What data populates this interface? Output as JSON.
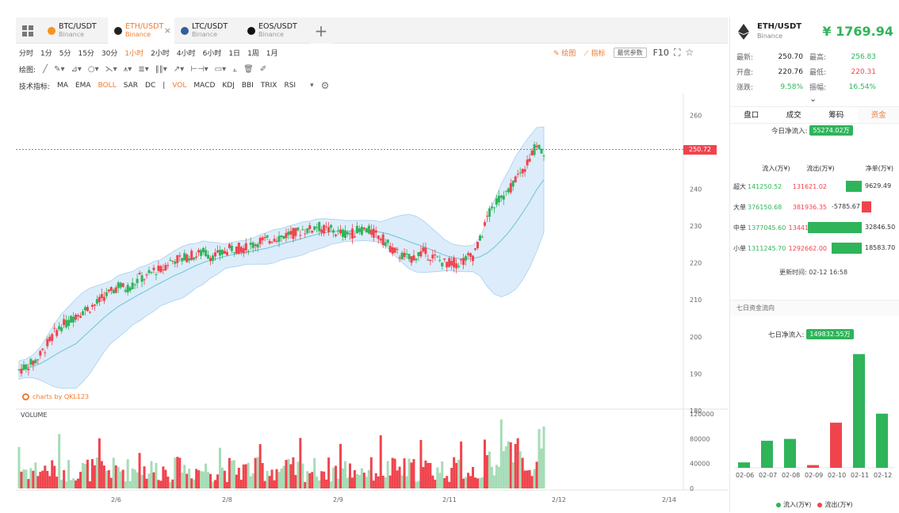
{
  "tabs": [
    {
      "pair": "BTC/USDT",
      "exchange": "Binance",
      "color": "#f7931a",
      "active": false
    },
    {
      "pair": "ETH/USDT",
      "exchange": "Binance",
      "color": "#222222",
      "active": true
    },
    {
      "pair": "LTC/USDT",
      "exchange": "Binance",
      "color": "#345d9d",
      "active": false
    },
    {
      "pair": "EOS/USDT",
      "exchange": "Binance",
      "color": "#111111",
      "active": false
    }
  ],
  "periods": [
    "分时",
    "1分",
    "5分",
    "15分",
    "30分",
    "1小时",
    "2小时",
    "4小时",
    "6小时",
    "1日",
    "1周",
    "1月"
  ],
  "active_period": "1小时",
  "draw_label": "绘图:",
  "indicators_label": "技术指标:",
  "indicators": [
    "MA",
    "EMA",
    "BOLL",
    "SAR",
    "DC",
    "|",
    "VOL",
    "MACD",
    "KDJ",
    "BBI",
    "TRIX",
    "RSI"
  ],
  "toolbar": {
    "draw": "绘图",
    "indicator": "指标",
    "params": "最优参数",
    "f10": "F10"
  },
  "chart_data": {
    "type": "candlestick",
    "price_ticks": [
      260,
      250,
      240,
      230,
      220,
      210,
      200,
      190,
      180
    ],
    "ylim": [
      180,
      262
    ],
    "volume_ticks": [
      120000,
      80000,
      40000,
      0
    ],
    "x_ticks": [
      "2/6",
      "2/8",
      "2/9",
      "2/11",
      "2/12",
      "2/14"
    ],
    "last_price": "250.72",
    "volume_label": "VOLUME",
    "watermark": "charts by QKL123",
    "close_path": [
      191,
      192,
      193,
      195,
      198,
      201,
      203,
      204,
      206,
      207,
      208,
      209,
      211,
      212,
      214,
      213,
      214,
      216,
      216,
      218,
      218,
      220,
      221,
      221,
      222,
      222,
      223,
      222,
      222,
      223,
      224,
      224,
      224,
      225,
      226,
      226,
      227,
      227,
      228,
      228,
      229,
      229,
      230,
      229,
      229,
      228,
      228,
      228,
      229,
      229,
      228,
      227,
      225,
      223,
      222,
      221,
      222,
      223,
      222,
      221,
      220,
      220,
      220,
      221,
      222,
      226,
      232,
      236,
      238,
      239,
      243,
      245,
      248,
      252,
      250
    ]
  },
  "ticker": {
    "pair": "ETH/USDT",
    "exchange": "Binance",
    "price": "¥ 1769.94",
    "stats": [
      {
        "k1": "最新:",
        "v1": "250.70",
        "c1": "dark",
        "k2": "最高:",
        "v2": "256.83",
        "c2": "green"
      },
      {
        "k1": "开盘:",
        "v1": "220.76",
        "c1": "dark",
        "k2": "最低:",
        "v2": "220.31",
        "c2": "red"
      },
      {
        "k1": "涨跌:",
        "v1": "9.58%",
        "c1": "green",
        "k2": "振幅:",
        "v2": "16.54%",
        "c2": "green"
      }
    ]
  },
  "right_tabs": [
    "盘口",
    "成交",
    "筹码",
    "资金"
  ],
  "active_right_tab": "资金",
  "flow": {
    "today_label": "今日净流入:",
    "today_value": "55274.02万",
    "headers": [
      "流入(万¥)",
      "流出(万¥)",
      "净单(万¥)"
    ],
    "rows": [
      {
        "name": "超大",
        "in": "141250.52",
        "out": "131621.02",
        "net": "9629.49",
        "net_value": 9629.49
      },
      {
        "name": "大单",
        "in": "376150.68",
        "out": "381936.35",
        "net": "-5785.67",
        "net_value": -5785.67
      },
      {
        "name": "中单",
        "in": "1377045.60",
        "out": "1344199.10",
        "net": "32846.50",
        "net_value": 32846.5
      },
      {
        "name": "小单",
        "in": "1311245.70",
        "out": "1292662.00",
        "net": "18583.70",
        "net_value": 18583.7
      }
    ],
    "updated": "更新时间: 02-12 16:58"
  },
  "seven_day": {
    "title": "七日资金流向",
    "label": "七日净流入:",
    "value": "149832.55万",
    "chart_data": {
      "type": "bar",
      "categories": [
        "02-06",
        "02-07",
        "02-08",
        "02-09",
        "02-10",
        "02-11",
        "02-12"
      ],
      "values": [
        3,
        15,
        16,
        1.5,
        25,
        63,
        30
      ],
      "series_colors": [
        "#2fb45a",
        "#2fb45a",
        "#2fb45a",
        "#f0444d",
        "#f0444d",
        "#2fb45a",
        "#2fb45a"
      ]
    },
    "legend_in": "流入(万¥)",
    "legend_out": "流出(万¥)"
  },
  "colors": {
    "up": "#2fb45a",
    "down": "#f0444d",
    "accent": "#f07b2e",
    "band": "#dcecfa"
  }
}
